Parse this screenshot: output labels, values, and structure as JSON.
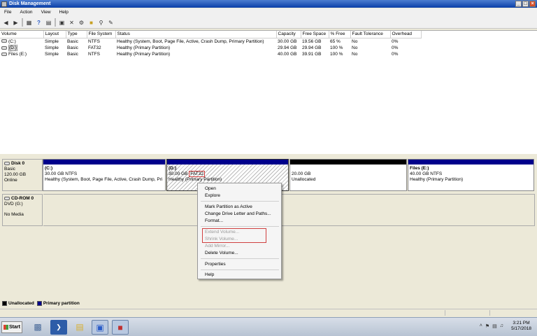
{
  "window": {
    "title": "Disk Management",
    "buttons": [
      "_",
      "□",
      "×"
    ]
  },
  "menu": [
    "File",
    "Action",
    "View",
    "Help"
  ],
  "toolbar": {
    "icons": [
      "back-icon",
      "forward-icon",
      "console-tree-icon",
      "help-icon",
      "properties-icon",
      "refresh-icon",
      "delete-icon",
      "settings-icon",
      "open-icon",
      "search-icon",
      "rescan-icon"
    ]
  },
  "volumes": {
    "columns": [
      "Volume",
      "Layout",
      "Type",
      "File System",
      "Status",
      "Capacity",
      "Free Space",
      "% Free",
      "Fault Tolerance",
      "Overhead"
    ],
    "rows": [
      [
        "(C:)",
        "Simple",
        "Basic",
        "NTFS",
        "Healthy (System, Boot, Page File, Active, Crash Dump, Primary Partition)",
        "30.00 GB",
        "19.56 GB",
        "65 %",
        "No",
        "0%"
      ],
      [
        "(D:)",
        "Simple",
        "Basic",
        "FAT32",
        "Healthy (Primary Partition)",
        "29.94 GB",
        "29.94 GB",
        "100 %",
        "No",
        "0%"
      ],
      [
        "Files (E:)",
        "Simple",
        "Basic",
        "NTFS",
        "Healthy (Primary Partition)",
        "40.00 GB",
        "39.91 GB",
        "100 %",
        "No",
        "0%"
      ]
    ]
  },
  "disk0": {
    "name": "Disk 0",
    "type": "Basic",
    "size": "120.00 GB",
    "status": "Online",
    "partitions": [
      {
        "name": "(C:)",
        "size": "30.00 GB NTFS",
        "status": "Healthy (System, Boot, Page File, Active, Crash Dump, Pri"
      },
      {
        "name": "(D:)",
        "size": "30.00 GB",
        "fs": "FAT32",
        "status": "Healthy (Primary Partition)"
      },
      {
        "name": "",
        "size": "20.00 GB",
        "status": "Unallocated"
      },
      {
        "name": "Files  (E:)",
        "size": "40.00 GB NTFS",
        "status": "Healthy (Primary Partition)"
      }
    ]
  },
  "cdrom": {
    "name": "CD-ROM 0",
    "type": "DVD (G:)",
    "status": "No Media"
  },
  "legend": [
    "Unallocated",
    "Primary partition"
  ],
  "context_menu": {
    "items": [
      "Open",
      "Explore",
      "Mark Partition as Active",
      "Change Drive Letter and Paths...",
      "Format...",
      "Extend Volume...",
      "Shrink Volume...",
      "Add Mirror...",
      "Delete Volume...",
      "Properties",
      "Help"
    ]
  },
  "taskbar": {
    "start": "Start",
    "time": "3:21 PM",
    "date": "5/17/2018"
  }
}
